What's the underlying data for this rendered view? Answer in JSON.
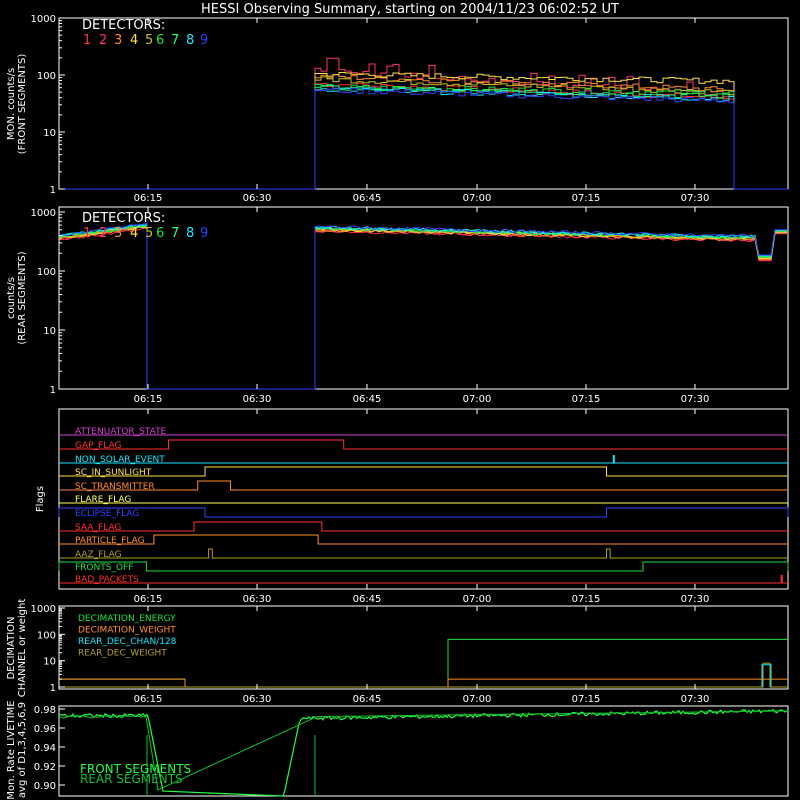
{
  "chart_data": [
    {
      "type": "line",
      "title": "HESSI Observing Summary, starting on 2004/11/23 06:02:52 UT",
      "ylabel_lines": [
        "MON. counts/s",
        "(FRONT SEGMENTS)"
      ],
      "yscale": "log",
      "ylim": [
        1,
        1000
      ],
      "yticks": [
        "1",
        "10",
        "100",
        "1000"
      ],
      "xticks": [
        "06:15",
        "06:30",
        "06:45",
        "07:00",
        "07:15",
        "07:30"
      ],
      "xlim_minutes": [
        6.0,
        47.8
      ],
      "legend_title": "DETECTORS:",
      "legend_placement": "top-left",
      "legend": [
        "1",
        "2",
        "3",
        "4",
        "5",
        "6",
        "7",
        "8",
        "9"
      ],
      "colors": [
        "#ff3030",
        "#ff3366",
        "#ff8c2a",
        "#ffe040",
        "#c8c020",
        "#20e040",
        "#20ff70",
        "#10e8ff",
        "#3040ff"
      ],
      "active_intervals": [
        [
          39.0,
          47.5
        ]
      ],
      "series_levels_start": [
        70,
        125,
        95,
        105,
        85,
        62,
        60,
        58,
        55
      ],
      "series_levels_end": [
        40,
        45,
        55,
        78,
        50,
        48,
        42,
        38,
        35
      ]
    },
    {
      "type": "line",
      "ylabel_lines": [
        "counts/s",
        "(REAR SEGMENTS)"
      ],
      "yscale": "log",
      "ylim": [
        1,
        1000
      ],
      "yticks": [
        "1",
        "10",
        "100",
        "1000"
      ],
      "xticks": [
        "06:15",
        "06:30",
        "06:45",
        "07:00",
        "07:15",
        "07:30"
      ],
      "legend_title": "DETECTORS:",
      "legend_placement": "top-left",
      "legend": [
        "1",
        "2",
        "3",
        "4",
        "5",
        "6",
        "7",
        "8",
        "9"
      ],
      "active_intervals": [
        [
          0.0,
          16.5
        ],
        [
          39.0,
          50.0
        ]
      ],
      "level_start": 320,
      "level_at_gap_start": 500,
      "level_after_gap": 450,
      "level_end": 320,
      "dip_minute": 48.4,
      "dip_value": 130
    },
    {
      "type": "flags",
      "ylabel": "Flags",
      "xticks": [
        "06:15",
        "06:30",
        "06:45",
        "07:00",
        "07:15",
        "07:30"
      ],
      "flags": [
        {
          "name": "ATTENUATOR_STATE",
          "color": "#d040d0",
          "on": []
        },
        {
          "name": "GAP_FLAG",
          "color": "#ff3030",
          "on": [
            [
              15.0,
              39.0
            ]
          ]
        },
        {
          "name": "NON_SOLAR_EVENT",
          "color": "#10e8ff",
          "on": [],
          "spike": 76.0
        },
        {
          "name": "SC_IN_SUNLIGHT",
          "color": "#ffe040",
          "on": [
            [
              20.0,
              75.0
            ]
          ]
        },
        {
          "name": "SC_TRANSMITTER",
          "color": "#ff8c2a",
          "on": [
            [
              19.0,
              23.5
            ]
          ]
        },
        {
          "name": "FLARE_FLAG",
          "color": "#ffff60",
          "on": []
        },
        {
          "name": "ECLIPSE_FLAG",
          "color": "#3040ff",
          "on": [
            [
              0.0,
              20.0
            ],
            [
              75.0,
              110.0
            ]
          ]
        },
        {
          "name": "SAA_FLAG",
          "color": "#ff3030",
          "on": [
            [
              18.5,
              36.0
            ]
          ]
        },
        {
          "name": "PARTICLE_FLAG",
          "color": "#ff8c2a",
          "on": [
            [
              13.0,
              35.5
            ]
          ]
        },
        {
          "name": "AAZ_FLAG",
          "color": "#b0a020",
          "on": [
            [
              20.5,
              21.0
            ],
            [
              75.0,
              75.5
            ]
          ]
        },
        {
          "name": "FRONTS_OFF",
          "color": "#20e040",
          "on": [
            [
              0.0,
              12.0
            ],
            [
              80.0,
              110.0
            ]
          ]
        },
        {
          "name": "BAD_PACKETS",
          "color": "#ff3030",
          "on": [],
          "spike": 99.0
        }
      ]
    },
    {
      "type": "line",
      "ylabel_lines": [
        "DECIMATION",
        "CHANNEL or weight"
      ],
      "yscale": "log",
      "ylim": [
        1,
        1000
      ],
      "yticks": [
        "1",
        "10",
        "100",
        "1000"
      ],
      "xticks": [
        "06:15",
        "06:30",
        "06:45",
        "07:00",
        "07:15",
        "07:30"
      ],
      "legend": [
        {
          "name": "DECIMATION_ENERGY",
          "color": "#20e040"
        },
        {
          "name": "DECIMATION_WEIGHT",
          "color": "#ff8c2a"
        },
        {
          "name": "REAR_DEC_CHAN/128",
          "color": "#10e8ff"
        },
        {
          "name": "REAR_DEC_WEIGHT",
          "color": "#b0a020"
        }
      ]
    },
    {
      "type": "line",
      "ylabel_lines": [
        "Mon. Rate LIVETIME",
        "avg of D1,3,4,5,6,9"
      ],
      "ylim": [
        0.9,
        0.98
      ],
      "yticks": [
        "0.90",
        "0.92",
        "0.94",
        "0.96",
        "0.98"
      ],
      "legend": [
        {
          "name": "FRONT SEGMENTS",
          "color": "#20ff40"
        },
        {
          "name": "REAR SEGMENTS",
          "color": "#10c030"
        }
      ]
    }
  ]
}
